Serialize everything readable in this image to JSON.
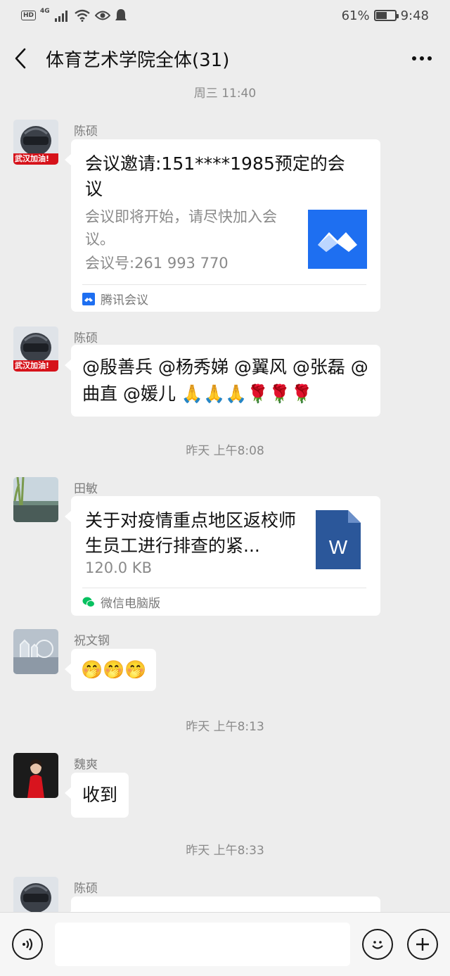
{
  "status_bar": {
    "network": "4G",
    "hd": "HD",
    "battery": "61%",
    "battery_level": 0.61,
    "time": "9:48"
  },
  "header": {
    "title": "体育艺术学院全体(31)"
  },
  "timestamps": [
    "周三 11:40",
    "昨天 上午8:08",
    "昨天 上午8:13",
    "昨天 上午8:33"
  ],
  "messages": [
    {
      "sender": "陈硕",
      "type": "card",
      "title": "会议邀请:151****1985预定的会议",
      "desc_1": "会议即将开始，请尽快加入会议。",
      "desc_2": "会议号:261 993 770",
      "source": "腾讯会议",
      "avatar_badge": "武汉加油!"
    },
    {
      "sender": "陈硕",
      "type": "text",
      "text": "@殷善兵 @杨秀娣 @翼风 @张磊 @曲直 @媛儿 🙏🙏🙏🌹🌹🌹",
      "avatar_badge": "武汉加油!"
    },
    {
      "sender": "田敏",
      "type": "file",
      "title": "关于对疫情重点地区返校师生员工进行排查的紧...",
      "size": "120.0 KB",
      "source": "微信电脑版",
      "file_icon_letter": "W"
    },
    {
      "sender": "祝文钢",
      "type": "text",
      "text": "🤭🤭🤭"
    },
    {
      "sender": "魏爽",
      "type": "text",
      "text": "收到"
    },
    {
      "sender": "陈硕",
      "type": "text",
      "text": "",
      "avatar_badge": "武汉加油!"
    }
  ],
  "icons": {
    "back": "chevron-left-icon",
    "more": "more-dots-icon",
    "voice": "voice-icon",
    "emoji": "emoji-icon",
    "add": "plus-icon"
  },
  "colors": {
    "background": "#ededed",
    "bubble": "#ffffff",
    "tencent_meeting": "#1e6ff1",
    "word_doc": "#2b579a",
    "wechat_green": "#07c160"
  }
}
